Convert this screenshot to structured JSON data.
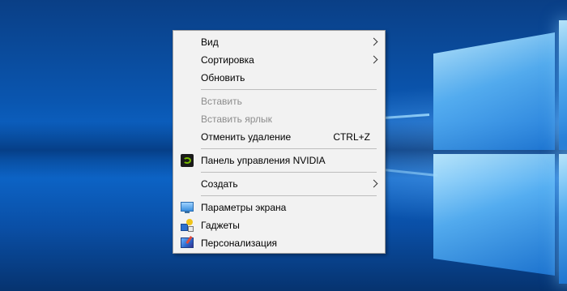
{
  "desktop": {
    "wallpaper": "windows-10-hero"
  },
  "context_menu": {
    "items": [
      {
        "label": "Вид",
        "submenu": true,
        "enabled": true
      },
      {
        "label": "Сортировка",
        "submenu": true,
        "enabled": true
      },
      {
        "label": "Обновить",
        "enabled": true
      },
      {
        "label": "Вставить",
        "enabled": false
      },
      {
        "label": "Вставить ярлык",
        "enabled": false
      },
      {
        "label": "Отменить удаление",
        "shortcut": "CTRL+Z",
        "enabled": true
      },
      {
        "label": "Панель управления NVIDIA",
        "icon": "nvidia-icon",
        "enabled": true
      },
      {
        "label": "Создать",
        "submenu": true,
        "enabled": true
      },
      {
        "label": "Параметры экрана",
        "icon": "display-settings-icon",
        "enabled": true
      },
      {
        "label": "Гаджеты",
        "icon": "gadgets-icon",
        "enabled": true
      },
      {
        "label": "Персонализация",
        "icon": "personalization-icon",
        "enabled": true
      }
    ]
  },
  "colors": {
    "menu_background": "#f2f2f2",
    "disabled_text": "#8d8d8d",
    "separator": "#bdbdbd",
    "desktop_blue": "#0a56b0"
  }
}
